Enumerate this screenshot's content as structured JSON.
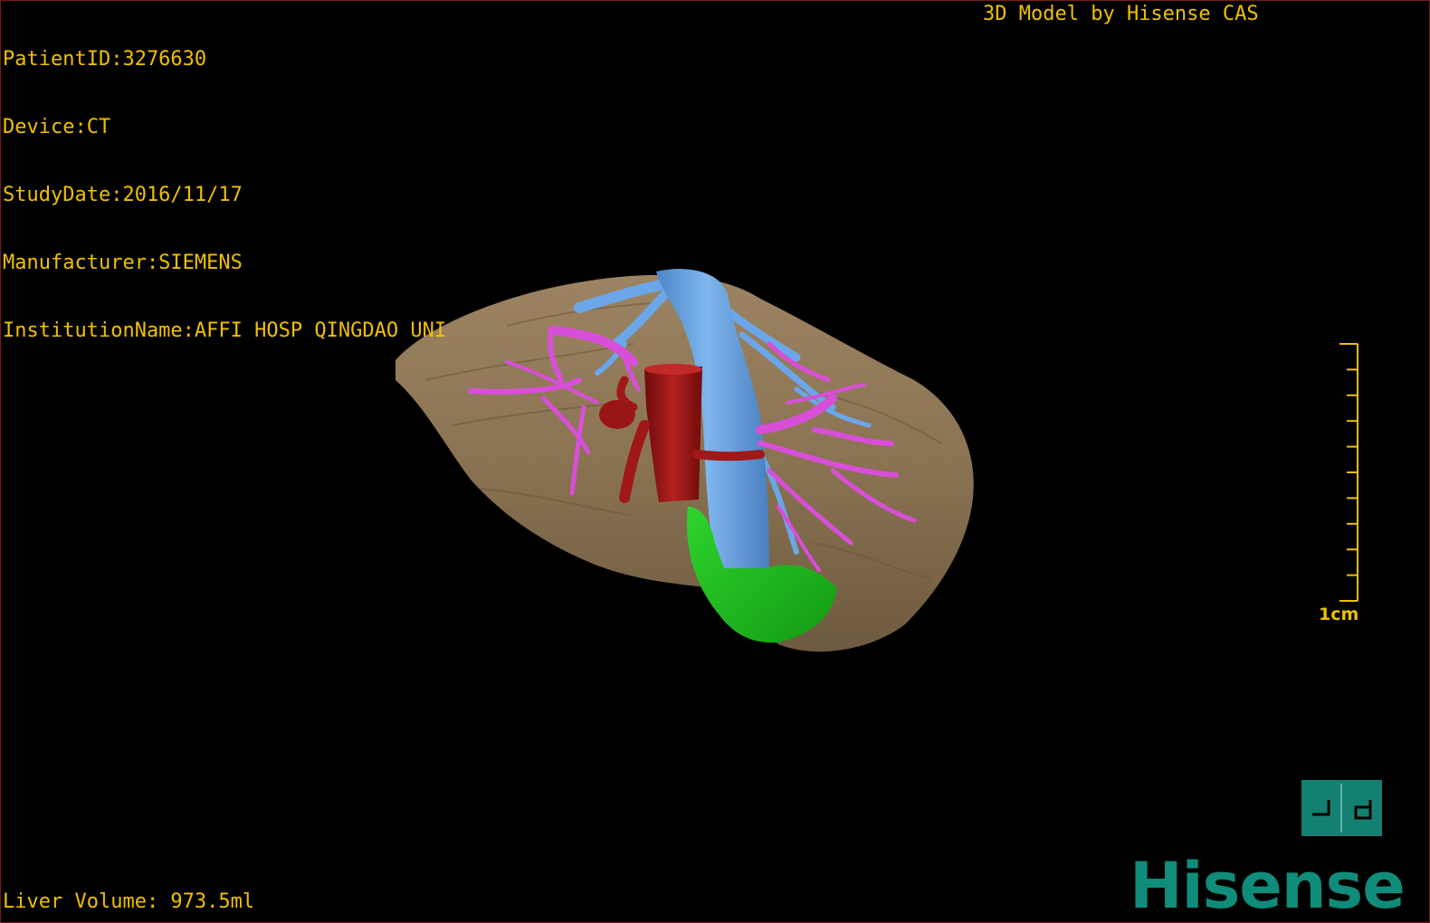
{
  "header": {
    "patient_id": "PatientID:3276630",
    "device": "Device:CT",
    "study_date": "StudyDate:2016/11/17",
    "manufacturer": "Manufacturer:SIEMENS",
    "institution": "InstitutionName:AFFI HOSP QINGDAO UNI"
  },
  "title": "3D Model by Hisense CAS",
  "footer": {
    "liver_volume": "Liver Volume: 973.5ml"
  },
  "scale_bar": {
    "label": "1cm",
    "ticks": 10
  },
  "logo": {
    "text": "Hisense",
    "color": "#0f8c7a"
  },
  "view_button": {
    "icon": "view-orientation-icon",
    "color": "#138072"
  },
  "colors": {
    "text": "#f0c000",
    "liver": "#8c7656",
    "hepatic_vein": "#6aa6e8",
    "portal_vein": "#d94ed9",
    "artery": "#a01818",
    "gallbladder": "#1fbf1f"
  }
}
